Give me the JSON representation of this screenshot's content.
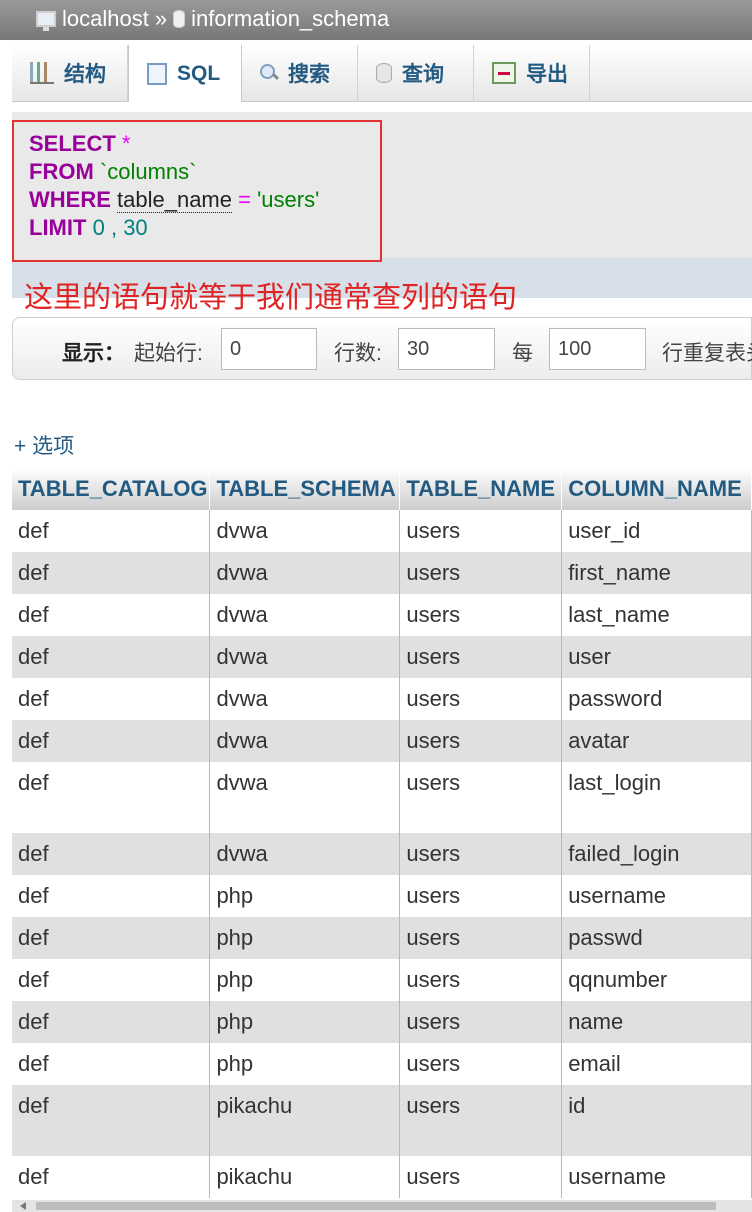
{
  "breadcrumb": {
    "server": "localhost",
    "separator": "»",
    "database": "information_schema"
  },
  "tabs": [
    {
      "label": "结构",
      "icon": "structure-icon"
    },
    {
      "label": "SQL",
      "icon": "sql-icon",
      "active": true
    },
    {
      "label": "搜索",
      "icon": "search-icon"
    },
    {
      "label": "查询",
      "icon": "query-icon"
    },
    {
      "label": "导出",
      "icon": "export-icon"
    }
  ],
  "sql": {
    "line1_kw": "SELECT",
    "line1_star": "*",
    "line2_kw": "FROM",
    "line2_table": "`columns`",
    "line3_kw": "WHERE",
    "line3_col": "table_name",
    "line3_op": "=",
    "line3_val": "'users'",
    "line4_kw": "LIMIT",
    "line4_offset": "0",
    "line4_sep": ",",
    "line4_count": "30"
  },
  "annotation": "这里的语句就等于我们通常查列的语句",
  "display_bar": {
    "show_label": "显示：",
    "start_label": "起始行:",
    "start_value": "0",
    "rows_label": "行数:",
    "rows_value": "30",
    "every_label": "每",
    "every_value": "100",
    "repeat_label": "行重复表头"
  },
  "options_link": "+ 选项",
  "table": {
    "columns": [
      "TABLE_CATALOG",
      "TABLE_SCHEMA",
      "TABLE_NAME",
      "COLUMN_NAME"
    ],
    "rows": [
      [
        "def",
        "dvwa",
        "users",
        "user_id"
      ],
      [
        "def",
        "dvwa",
        "users",
        "first_name"
      ],
      [
        "def",
        "dvwa",
        "users",
        "last_name"
      ],
      [
        "def",
        "dvwa",
        "users",
        "user"
      ],
      [
        "def",
        "dvwa",
        "users",
        "password"
      ],
      [
        "def",
        "dvwa",
        "users",
        "avatar"
      ],
      [
        "def",
        "dvwa",
        "users",
        "last_login"
      ],
      [
        "def",
        "dvwa",
        "users",
        "failed_login"
      ],
      [
        "def",
        "php",
        "users",
        "username"
      ],
      [
        "def",
        "php",
        "users",
        "passwd"
      ],
      [
        "def",
        "php",
        "users",
        "qqnumber"
      ],
      [
        "def",
        "php",
        "users",
        "name"
      ],
      [
        "def",
        "php",
        "users",
        "email"
      ],
      [
        "def",
        "pikachu",
        "users",
        "id"
      ],
      [
        "def",
        "pikachu",
        "users",
        "username"
      ]
    ]
  },
  "colors": {
    "accent": "#235a81",
    "annotation": "#e02222",
    "keyword": "#990099",
    "string": "#008000",
    "number": "#008080"
  }
}
